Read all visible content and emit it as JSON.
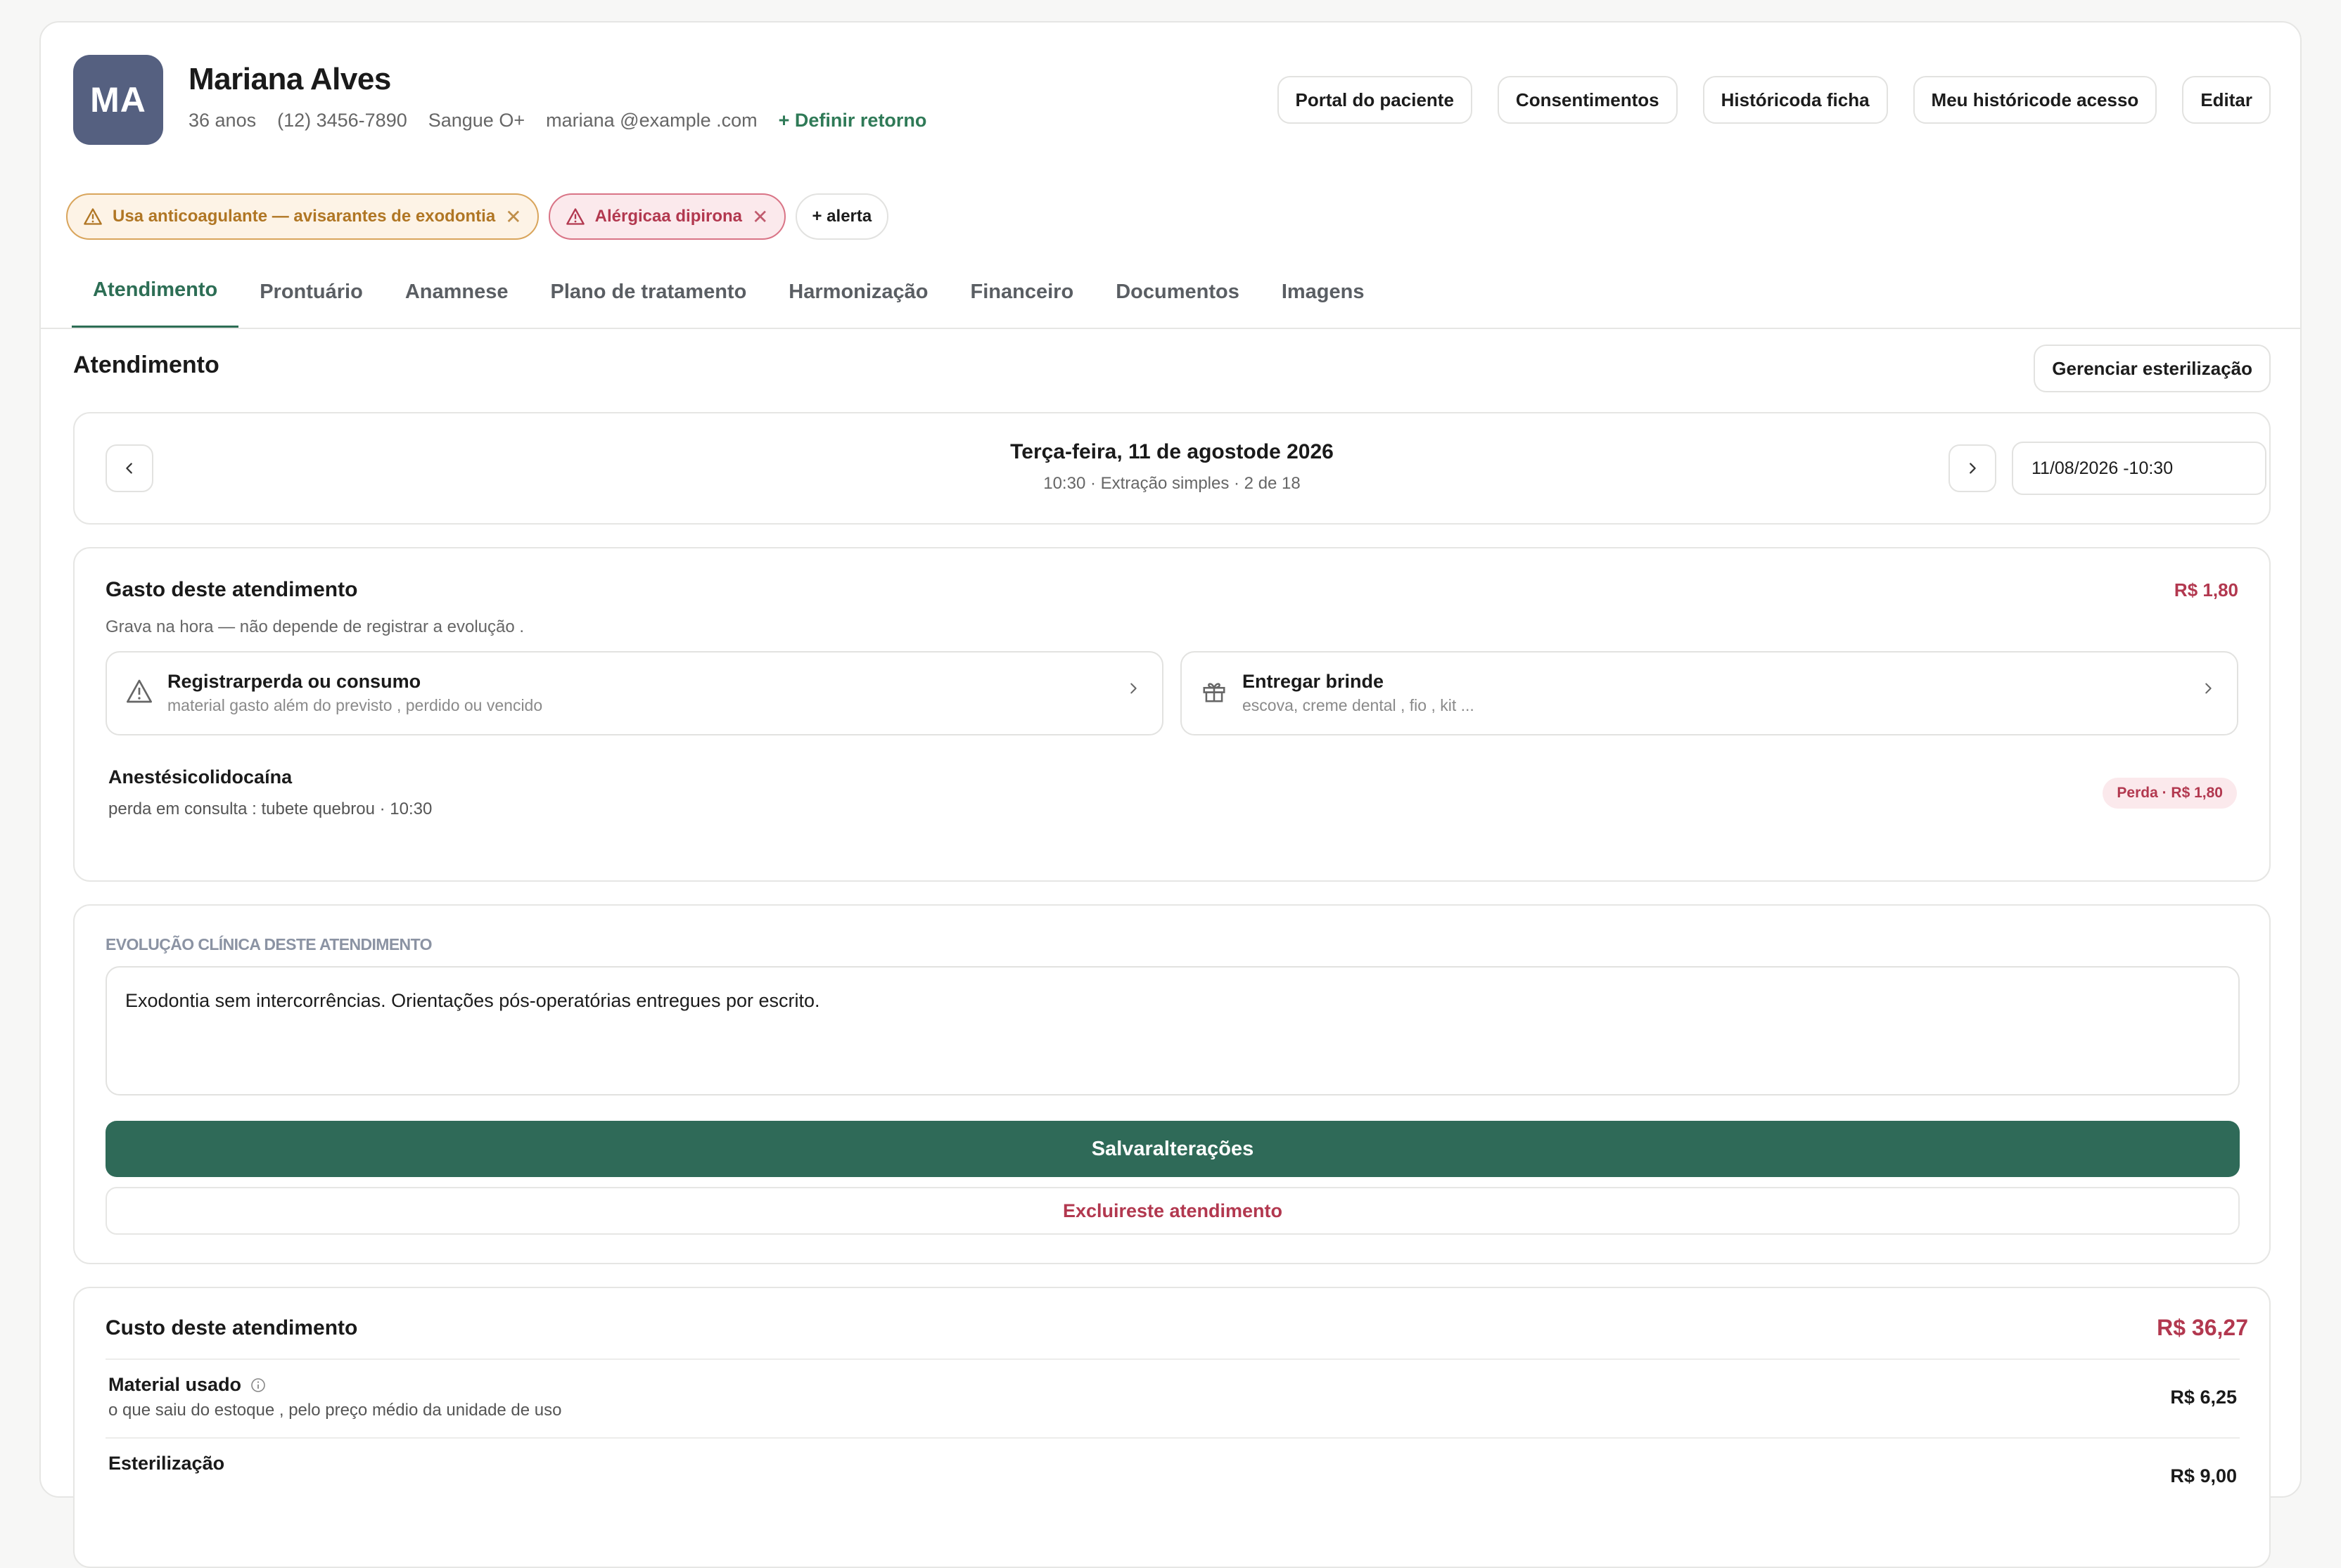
{
  "patient": {
    "initials": "MA",
    "name": "Mariana Alves",
    "age": "36 anos",
    "phone": "(12) 3456-7890",
    "blood": "Sangue O+",
    "email": "mariana @example .com",
    "return_label": "+ Definir retorno"
  },
  "header_buttons": {
    "portal": "Portal do paciente",
    "consents": "Consentimentos",
    "history": "Históricoda ficha",
    "access": "Meu históricode acesso",
    "edit": "Editar"
  },
  "alerts": {
    "anticoag": "Usa anticoagulante — avisarantes de exodontia",
    "allergy": "Alérgicaa dipirona",
    "add": "+ alerta"
  },
  "tabs": [
    "Atendimento",
    "Prontuário",
    "Anamnese",
    "Plano de tratamento",
    "Harmonização",
    "Financeiro",
    "Documentos",
    "Imagens"
  ],
  "section": {
    "title": "Atendimento",
    "steril_button": "Gerenciar esterilização"
  },
  "appointment": {
    "date": "Terça-feira, 11 de agostode 2026",
    "sub": "10:30 · Extração simples · 2 de 18",
    "datetime_value": "11/08/2026 -10:30"
  },
  "gasto": {
    "title": "Gasto deste atendimento",
    "subtitle": "Grava na hora — não depende de registrar a evolução .",
    "amount": "R$ 1,80",
    "action_loss_title": "Registrarperda ou consumo",
    "action_loss_sub": "material gasto além do previsto , perdido ou vencido",
    "action_gift_title": "Entregar brinde",
    "action_gift_sub": "escova, creme dental , fio , kit ...",
    "item_name": "Anestésicolidocaína",
    "item_desc": "perda em consulta : tubete quebrou · 10:30",
    "item_badge": "Perda · R$ 1,80"
  },
  "evolucao": {
    "label": "EVOLUÇÃO CLÍNICA DESTE ATENDIMENTO",
    "text": "Exodontia sem intercorrências. Orientações pós-operatórias entregues por escrito.",
    "save": "Salvaralterações",
    "delete": "Excluireste atendimento"
  },
  "custo": {
    "title": "Custo deste atendimento",
    "total": "R$ 36,27",
    "rows": [
      {
        "name": "Material usado",
        "desc": "o que saiu do estoque , pelo preço médio da unidade de uso",
        "value": "R$ 6,25"
      },
      {
        "name": "Esterilização",
        "desc": "",
        "value": "R$ 9,00"
      }
    ]
  },
  "colors": {
    "accent": "#2d6e55",
    "danger": "#b2384f",
    "warning": "#b07624",
    "avatar": "#556080"
  }
}
